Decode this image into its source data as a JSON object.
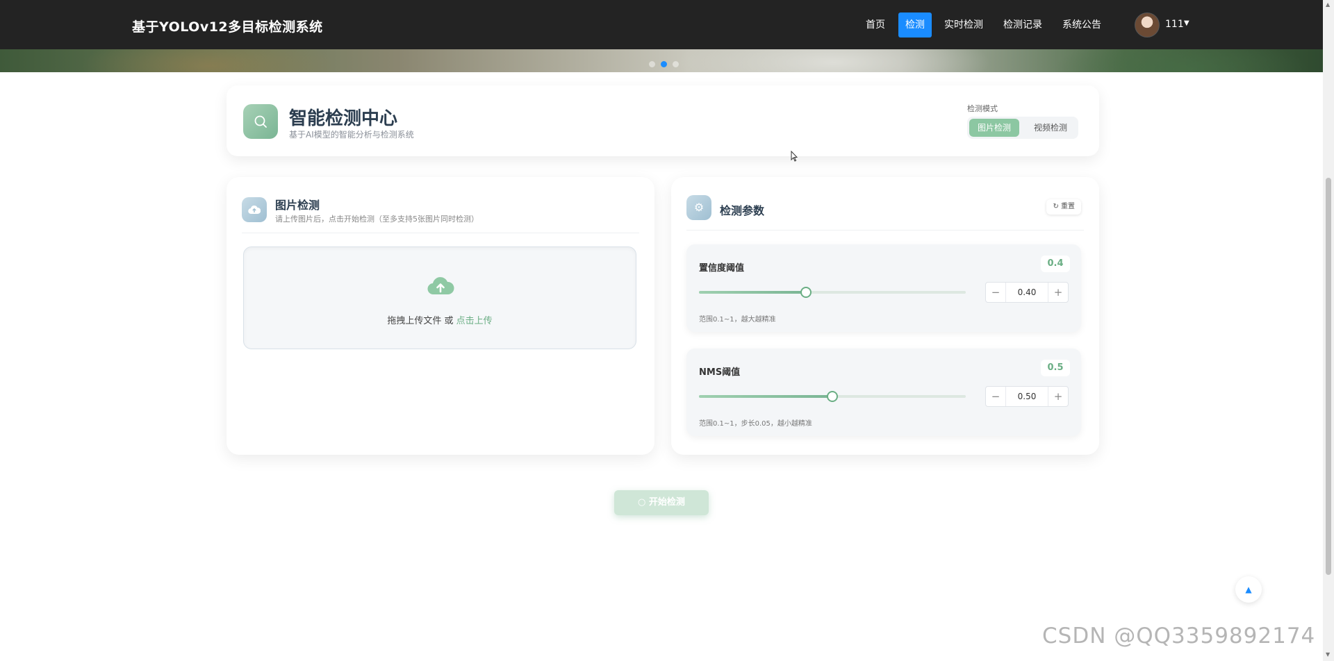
{
  "navbar": {
    "brand": "基于YOLOv12多目标检测系统",
    "links": [
      "首页",
      "检测",
      "实时检测",
      "检测记录",
      "系统公告"
    ],
    "active_link": "检测",
    "user": "111"
  },
  "carousel": {
    "dot_count": 3,
    "active_dot": 2
  },
  "header": {
    "title": "智能检测中心",
    "subtitle": "基于AI模型的智能分析与检测系统",
    "mode_label": "检测模式",
    "modes": [
      "图片检测",
      "视频检测"
    ],
    "active_mode": "图片检测"
  },
  "upload_panel": {
    "title": "图片检测",
    "subtitle": "请上传图片后，点击开始检测（至多支持5张图片同时检测）",
    "drop_text": "拖拽上传文件 或 ",
    "click_upload": "点击上传"
  },
  "params_panel": {
    "title": "检测参数",
    "reset": "重置",
    "params": [
      {
        "name": "置信度阈值",
        "badge": "0.4",
        "value": "0.40",
        "fraction": 0.4,
        "hint": "范围0.1~1，越大越精准"
      },
      {
        "name": "NMS阈值",
        "badge": "0.5",
        "value": "0.50",
        "fraction": 0.5,
        "hint": "范围0.1~1，步长0.05，越小越精准"
      }
    ],
    "minus": "−",
    "plus": "+"
  },
  "start_button": "开始检测",
  "watermark": "CSDN @QQ3359892174",
  "icons": {
    "header": "search-icon",
    "upload_panel": "cloud-upload-icon",
    "params_panel": "gear-icon",
    "reset": "refresh-icon",
    "back_to_top": "arrow-up-icon"
  },
  "colors": {
    "navbar": "#232323",
    "active_nav": "#1a8cff",
    "accent_green": "#7ab594",
    "accent_light_green": "#8cc7a2"
  }
}
